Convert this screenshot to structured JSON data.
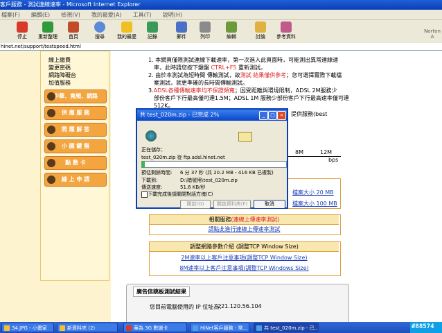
{
  "window": {
    "title": "客戶服務 - 測試連線速率 - Microsoft Internet Explorer"
  },
  "menu": [
    "檔案(F)",
    "編輯(E)",
    "檢視(V)",
    "我的最愛(A)",
    "工具(T)",
    "說明(H)"
  ],
  "toolbar": {
    "stop": "停止",
    "refresh": "重新整理",
    "home": "首頁",
    "search": "搜尋",
    "favorites": "我的最愛",
    "history": "記錄",
    "mail": "郵件",
    "print": "列印",
    "edit": "編輯",
    "discuss": "討論",
    "research": "參考資料",
    "brand": "Norton A"
  },
  "address": "hinet.net/support/testspeed.html",
  "leftnav": {
    "links": [
      "線上繳費",
      "變更密碼",
      "網路障礙台",
      "加值服務"
    ],
    "buttons": [
      "中華．寬頻．網路",
      "供 應 服 務",
      "問 題 解 答",
      "小 國 鍵 盤",
      "點 數 卡",
      "線 上 申 請"
    ]
  },
  "content": {
    "line1a": "1. 本網頁僅限測試連線下載速率，第一次進入此頁面時，可能測出異常連線速",
    "line1b": "率，此時請您按下鍵盤",
    "line1c": "CTRL+F5",
    "line1d": "重新測試。",
    "line2a": "2. 由於本測試為短時間 傳輸測試，故",
    "line2b": "測試 結果僅供參考",
    "line2c": "；您可選擇實際下載檔",
    "line2d": "案測試，就更準確的長時間傳輸測試。",
    "line3a": "3.",
    "line3b": "ADSL各種傳輸速率均不保證頻寬",
    "line3c": "；因受距離與環境限制，ADSL 2M服務少",
    "line3d": "部份客戶下行最高僅可達1.5M；ADSL 1M 服務少部份客戶下行最高速率僅可達",
    "line3e": "512K。",
    "partial1": "提供服務(best",
    "scale": {
      "label1": "8M",
      "label2": "12M",
      "unit": "bps"
    },
    "file_row1": "檔案大小 20 MB",
    "file_row2": "檔案大小 100 MB",
    "related": {
      "title": "相關服務",
      "title_red": "(連線上傳速率測試)",
      "link": "請點此進行連線上傳速率測試"
    },
    "tcp": {
      "title": "調整網路參數介紹 (調整TCP Window Size)",
      "link1": "2M速率以上客戶注意事項(調整TCP Window Size)",
      "link2": "8M速率以上客戶注意事項(調整TCP Windows Size)"
    },
    "ad": {
      "title": "廣告信跳板測試結果",
      "ip_label": "您目前電腦使用的 IP 位址為：",
      "ip": "221.120.56.104"
    }
  },
  "dialog": {
    "title": "共 test_020m.zip - 已完成 2%",
    "saving": "正在儲存：",
    "file_from": "test_020m.zip 從 ftp.adsl.hinet.net",
    "progress": 0.02,
    "eta_label": "預估剩餘時間:",
    "eta_value": "6 分 37 秒 (共 20.2 MB - 416 KB 已複製)",
    "dest_label": "下載到:",
    "dest_value": "D:\\暗號用\\test_020m.zip",
    "rate_label": "傳送速度:",
    "rate_value": "51.6 KB/秒",
    "close_checkbox": "下載完成後請關閉對話方塊(C)",
    "open_btn": "開啟(O)",
    "open_folder_btn": "開啟資料夾(F)",
    "cancel_btn": "取消"
  },
  "taskbar": [
    "34.JPG - 小畫家",
    "新資料夾 (2)",
    "華為 3G 數據卡",
    "HiNet客戶服務 - 常...",
    "共 test_020m.zip - 已..."
  ],
  "watermark": "#88574"
}
